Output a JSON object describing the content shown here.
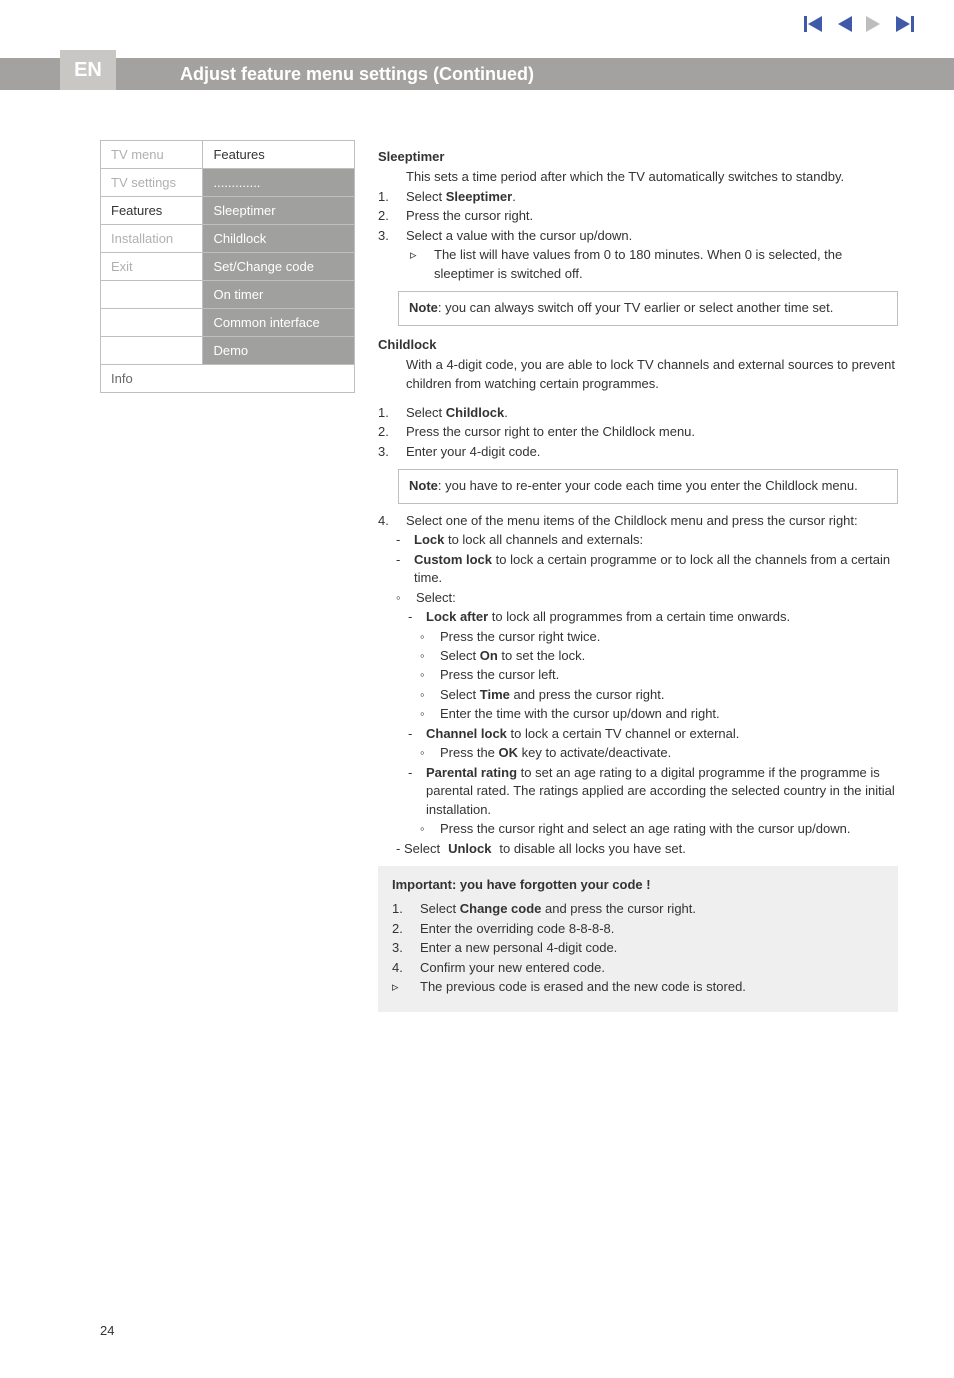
{
  "nav_colors": {
    "disabled": "#bdbdbd",
    "active": "#3f5aa9"
  },
  "header": {
    "badge": "EN",
    "title": "Adjust feature menu settings  (Continued)"
  },
  "menu": {
    "col_left_header": "TV menu",
    "col_right_header": "Features",
    "dots": ".............",
    "left": [
      "TV settings",
      "Features",
      "Installation",
      "Exit"
    ],
    "right": [
      "Sleeptimer",
      "Childlock",
      "Set/Change code",
      "On timer",
      "Common interface",
      "Demo"
    ],
    "info": "Info"
  },
  "sleeptimer": {
    "head": "Sleeptimer",
    "intro": "This sets a time period after which the TV automatically switches to standby.",
    "step1_num": "1.",
    "step1_a": "Select ",
    "step1_b": "Sleeptimer",
    "step1_c": ".",
    "step2_num": "2.",
    "step2": "Press the cursor right.",
    "step3_num": "3.",
    "step3": "Select a value with the cursor up/down.",
    "tri": "▹",
    "tri_text": "The list will have values from 0 to 180 minutes. When 0 is selected, the sleeptimer is switched off.",
    "note_a": "Note",
    "note_b": ": you can always switch off your TV earlier or select another time set."
  },
  "childlock": {
    "head": "Childlock",
    "intro": "With a 4-digit code, you are able to lock TV channels and external sources to prevent children from watching certain programmes.",
    "s1n": "1.",
    "s1a": "Select ",
    "s1b": "Childlock",
    "s1c": ".",
    "s2n": "2.",
    "s2": "Press the cursor right to enter the Childlock menu.",
    "s3n": "3.",
    "s3": "Enter your 4-digit code.",
    "note_a": "Note",
    "note_b": ": you have to re-enter your code each time you enter the Childlock menu.",
    "s4n": "4.",
    "s4": "Select one of the menu items of the Childlock menu and press the cursor right:",
    "d": "-",
    "ring": "◦",
    "lock_a": "Lock",
    "lock_b": " to lock all channels and externals:",
    "custom_a": "Custom lock",
    "custom_b": " to lock a certain programme or to lock all the channels from a certain time.",
    "select_label": "Select:",
    "lockafter_a": "Lock after",
    "lockafter_b": " to lock all programmes from a certain time onwards.",
    "la1": "Press the cursor right twice.",
    "la2a": "Select ",
    "la2b": "On",
    "la2c": " to set the lock.",
    "la3": "Press the cursor left.",
    "la4a": "Select ",
    "la4b": "Time",
    "la4c": " and press the cursor right.",
    "la5": "Enter the time with the cursor up/down and right.",
    "chlock_a": "Channel lock",
    "chlock_b": " to lock a certain TV channel or external.",
    "chlock_sub_a": " Press the ",
    "chlock_sub_b": "OK",
    "chlock_sub_c": " key to activate/deactivate.",
    "pr_a": "Parental rating",
    "pr_b": " to set an age rating to a digital programme if the programme is parental rated. The ratings applied are according the selected country in the initial installation.",
    "pr_sub": "Press the cursor right and select an age rating with the cursor up/down.",
    "unlock_a": "- Select ",
    "unlock_b": "Unlock",
    "unlock_c": " to disable all locks you have set."
  },
  "important": {
    "head": "Important: you have forgotten your code !",
    "s1n": "1.",
    "s1a": "Select ",
    "s1b": "Change code",
    "s1c": " and press the cursor right.",
    "s2n": "2.",
    "s2": "Enter the overriding code 8-8-8-8.",
    "s3n": "3.",
    "s3": "Enter a new personal 4-digit code.",
    "s4n": "4.",
    "s4": "Confirm your new entered code.",
    "tri": "▹",
    "tri_text": "The previous code is erased and the new code is stored."
  },
  "page_number": "24"
}
